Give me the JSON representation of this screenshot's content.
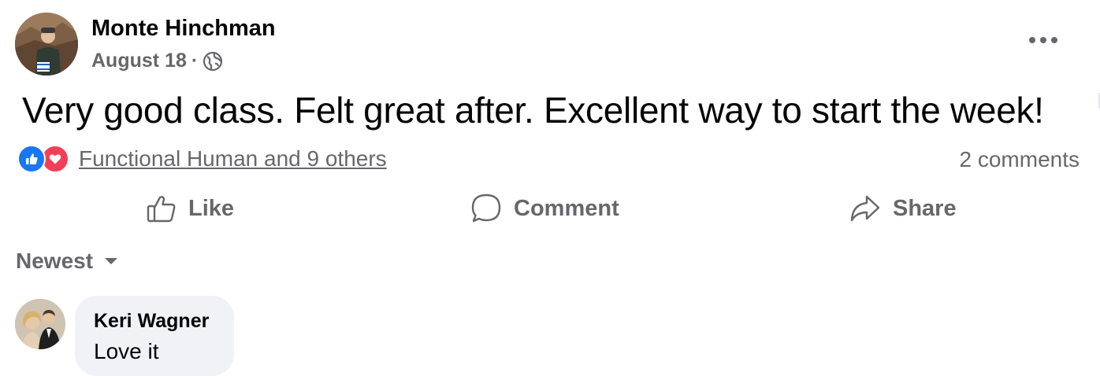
{
  "post": {
    "author": "Monte Hinchman",
    "date": "August 18",
    "separator": "·",
    "privacy_icon": "globe-icon",
    "more_icon": "more-horizontal-icon",
    "body": "Very good class. Felt great after. Excellent way to start the week!"
  },
  "reactions": {
    "icons": [
      "like-reaction-icon",
      "love-reaction-icon"
    ],
    "summary": "Functional Human and 9 others",
    "comments_count": "2 comments"
  },
  "actions": {
    "like": "Like",
    "comment": "Comment",
    "share": "Share"
  },
  "comments": {
    "sort_label": "Newest",
    "items": [
      {
        "author": "Keri Wagner",
        "text": "Love it"
      }
    ]
  },
  "colors": {
    "secondary_text": "#65676b",
    "like_blue": "#1877f2",
    "love_red": "#f33e58",
    "bubble_bg": "#f0f2f5"
  }
}
